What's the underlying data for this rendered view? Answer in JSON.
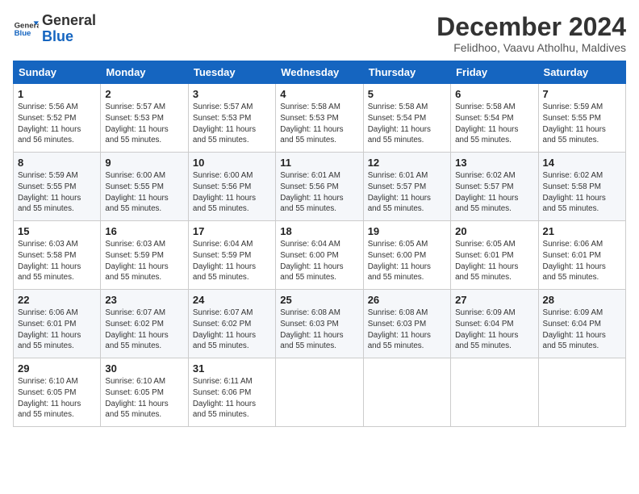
{
  "logo": {
    "text_general": "General",
    "text_blue": "Blue"
  },
  "title": "December 2024",
  "location": "Felidhoo, Vaavu Atholhu, Maldives",
  "days_of_week": [
    "Sunday",
    "Monday",
    "Tuesday",
    "Wednesday",
    "Thursday",
    "Friday",
    "Saturday"
  ],
  "weeks": [
    [
      {
        "day": "1",
        "info": "Sunrise: 5:56 AM\nSunset: 5:52 PM\nDaylight: 11 hours\nand 56 minutes."
      },
      {
        "day": "2",
        "info": "Sunrise: 5:57 AM\nSunset: 5:53 PM\nDaylight: 11 hours\nand 55 minutes."
      },
      {
        "day": "3",
        "info": "Sunrise: 5:57 AM\nSunset: 5:53 PM\nDaylight: 11 hours\nand 55 minutes."
      },
      {
        "day": "4",
        "info": "Sunrise: 5:58 AM\nSunset: 5:53 PM\nDaylight: 11 hours\nand 55 minutes."
      },
      {
        "day": "5",
        "info": "Sunrise: 5:58 AM\nSunset: 5:54 PM\nDaylight: 11 hours\nand 55 minutes."
      },
      {
        "day": "6",
        "info": "Sunrise: 5:58 AM\nSunset: 5:54 PM\nDaylight: 11 hours\nand 55 minutes."
      },
      {
        "day": "7",
        "info": "Sunrise: 5:59 AM\nSunset: 5:55 PM\nDaylight: 11 hours\nand 55 minutes."
      }
    ],
    [
      {
        "day": "8",
        "info": "Sunrise: 5:59 AM\nSunset: 5:55 PM\nDaylight: 11 hours\nand 55 minutes."
      },
      {
        "day": "9",
        "info": "Sunrise: 6:00 AM\nSunset: 5:55 PM\nDaylight: 11 hours\nand 55 minutes."
      },
      {
        "day": "10",
        "info": "Sunrise: 6:00 AM\nSunset: 5:56 PM\nDaylight: 11 hours\nand 55 minutes."
      },
      {
        "day": "11",
        "info": "Sunrise: 6:01 AM\nSunset: 5:56 PM\nDaylight: 11 hours\nand 55 minutes."
      },
      {
        "day": "12",
        "info": "Sunrise: 6:01 AM\nSunset: 5:57 PM\nDaylight: 11 hours\nand 55 minutes."
      },
      {
        "day": "13",
        "info": "Sunrise: 6:02 AM\nSunset: 5:57 PM\nDaylight: 11 hours\nand 55 minutes."
      },
      {
        "day": "14",
        "info": "Sunrise: 6:02 AM\nSunset: 5:58 PM\nDaylight: 11 hours\nand 55 minutes."
      }
    ],
    [
      {
        "day": "15",
        "info": "Sunrise: 6:03 AM\nSunset: 5:58 PM\nDaylight: 11 hours\nand 55 minutes."
      },
      {
        "day": "16",
        "info": "Sunrise: 6:03 AM\nSunset: 5:59 PM\nDaylight: 11 hours\nand 55 minutes."
      },
      {
        "day": "17",
        "info": "Sunrise: 6:04 AM\nSunset: 5:59 PM\nDaylight: 11 hours\nand 55 minutes."
      },
      {
        "day": "18",
        "info": "Sunrise: 6:04 AM\nSunset: 6:00 PM\nDaylight: 11 hours\nand 55 minutes."
      },
      {
        "day": "19",
        "info": "Sunrise: 6:05 AM\nSunset: 6:00 PM\nDaylight: 11 hours\nand 55 minutes."
      },
      {
        "day": "20",
        "info": "Sunrise: 6:05 AM\nSunset: 6:01 PM\nDaylight: 11 hours\nand 55 minutes."
      },
      {
        "day": "21",
        "info": "Sunrise: 6:06 AM\nSunset: 6:01 PM\nDaylight: 11 hours\nand 55 minutes."
      }
    ],
    [
      {
        "day": "22",
        "info": "Sunrise: 6:06 AM\nSunset: 6:01 PM\nDaylight: 11 hours\nand 55 minutes."
      },
      {
        "day": "23",
        "info": "Sunrise: 6:07 AM\nSunset: 6:02 PM\nDaylight: 11 hours\nand 55 minutes."
      },
      {
        "day": "24",
        "info": "Sunrise: 6:07 AM\nSunset: 6:02 PM\nDaylight: 11 hours\nand 55 minutes."
      },
      {
        "day": "25",
        "info": "Sunrise: 6:08 AM\nSunset: 6:03 PM\nDaylight: 11 hours\nand 55 minutes."
      },
      {
        "day": "26",
        "info": "Sunrise: 6:08 AM\nSunset: 6:03 PM\nDaylight: 11 hours\nand 55 minutes."
      },
      {
        "day": "27",
        "info": "Sunrise: 6:09 AM\nSunset: 6:04 PM\nDaylight: 11 hours\nand 55 minutes."
      },
      {
        "day": "28",
        "info": "Sunrise: 6:09 AM\nSunset: 6:04 PM\nDaylight: 11 hours\nand 55 minutes."
      }
    ],
    [
      {
        "day": "29",
        "info": "Sunrise: 6:10 AM\nSunset: 6:05 PM\nDaylight: 11 hours\nand 55 minutes."
      },
      {
        "day": "30",
        "info": "Sunrise: 6:10 AM\nSunset: 6:05 PM\nDaylight: 11 hours\nand 55 minutes."
      },
      {
        "day": "31",
        "info": "Sunrise: 6:11 AM\nSunset: 6:06 PM\nDaylight: 11 hours\nand 55 minutes."
      },
      {
        "day": "",
        "info": ""
      },
      {
        "day": "",
        "info": ""
      },
      {
        "day": "",
        "info": ""
      },
      {
        "day": "",
        "info": ""
      }
    ]
  ]
}
